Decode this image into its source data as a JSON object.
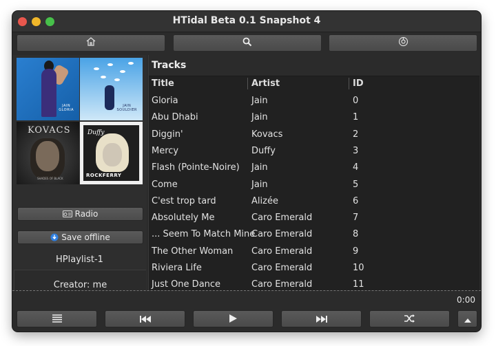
{
  "window": {
    "title": "HTidal Beta 0.1 Snapshot 4"
  },
  "toolbar": {
    "icons": [
      "home-icon",
      "search-icon",
      "settings-icon"
    ]
  },
  "album_art": [
    {
      "caption": "JAIN\nGLORIA"
    },
    {
      "caption": "JAIN\nSOULDIER"
    },
    {
      "caption": "KOVACS",
      "subtitle": "SHADES OF BLACK"
    },
    {
      "caption": "ROCKFERRY",
      "signature": "Duffy"
    }
  ],
  "sidebar": {
    "radio_label": "Radio",
    "save_offline_label": "Save offline",
    "playlist_name": "HPlaylist-1",
    "creator": "Creator: me"
  },
  "tracks": {
    "heading": "Tracks",
    "columns": {
      "title": "Title",
      "artist": "Artist",
      "id": "ID"
    },
    "rows": [
      {
        "title": "Gloria",
        "artist": "Jain",
        "id": "0"
      },
      {
        "title": "Abu Dhabi",
        "artist": "Jain",
        "id": "1"
      },
      {
        "title": "Diggin'",
        "artist": "Kovacs",
        "id": "2"
      },
      {
        "title": "Mercy",
        "artist": "Duffy",
        "id": "3"
      },
      {
        "title": "Flash (Pointe-Noire)",
        "artist": "Jain",
        "id": "4"
      },
      {
        "title": "Come",
        "artist": "Jain",
        "id": "5"
      },
      {
        "title": "C'est trop tard",
        "artist": "Alizée",
        "id": "6"
      },
      {
        "title": "Absolutely Me",
        "artist": "Caro Emerald",
        "id": "7"
      },
      {
        "title": "... Seem To Match Mine",
        "artist": "Caro Emerald",
        "id": "8"
      },
      {
        "title": "The Other Woman",
        "artist": "Caro Emerald",
        "id": "9"
      },
      {
        "title": "Riviera Life",
        "artist": "Caro Emerald",
        "id": "10"
      },
      {
        "title": "Just One Dance",
        "artist": "Caro Emerald",
        "id": "11"
      }
    ]
  },
  "player": {
    "time": "0:00",
    "controls": [
      "queue-icon",
      "previous-icon",
      "play-icon",
      "next-icon",
      "shuffle-icon",
      "expand-up-icon"
    ]
  },
  "colors": {
    "window_bg": "#2b2b2b",
    "list_bg": "#212121",
    "button": "#525252"
  }
}
